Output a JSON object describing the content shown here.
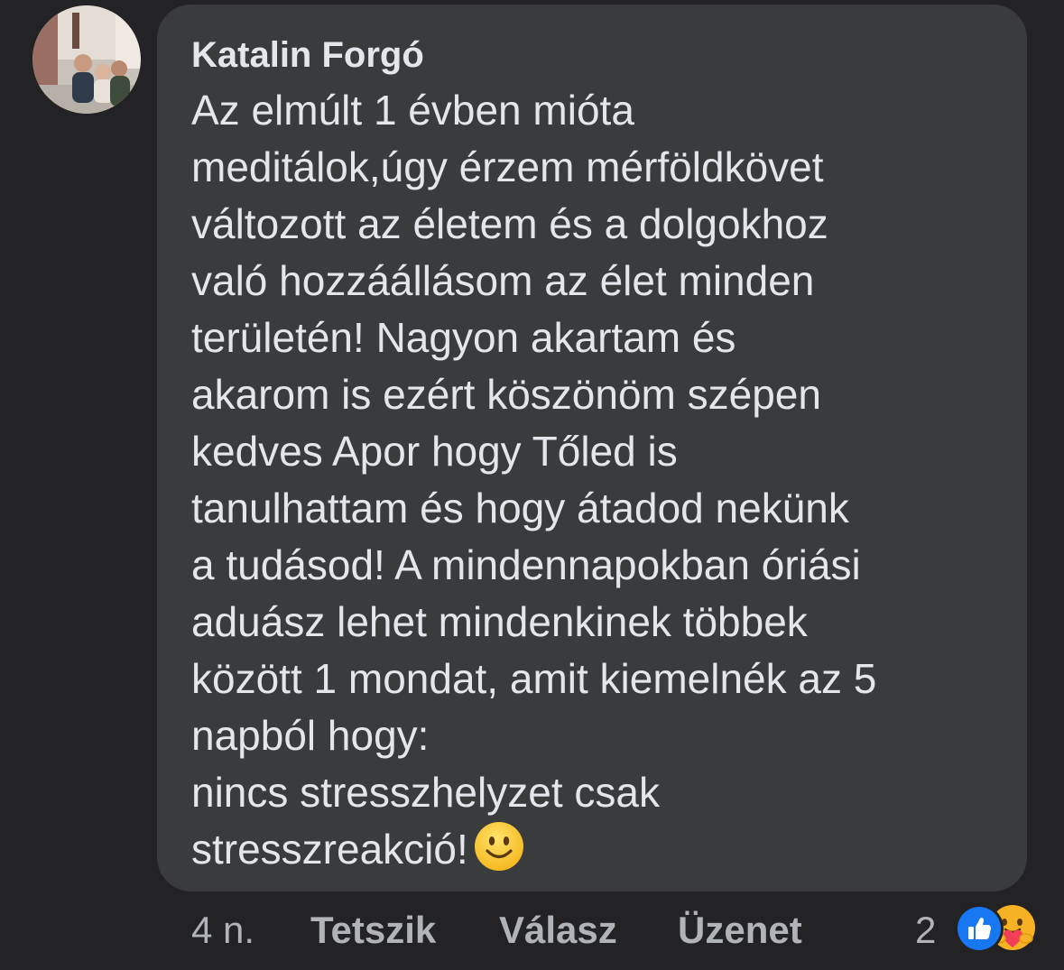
{
  "comment": {
    "author": "Katalin Forgó",
    "text": "Az elmúlt 1 évben mióta\nmeditálok,úgy érzem mérföldkövet\nváltozott az életem és a dolgokhoz\nvaló hozzáállásom az élet minden\nterületén! Nagyon  akartam és\nakarom is ezért köszönöm szépen\nkedves Apor hogy Tőled is\ntanulhattam és hogy átadod nekünk\na tudásod! A mindennapokban óriási\naduász lehet mindenkinek többek\nközött 1 mondat, amit kiemelnék az 5\nnapból hogy:\n nincs stresszhelyzet csak\nstresszreakció!",
    "emoji": "slightly-smiling-face-emoji"
  },
  "actions": {
    "time": "4 n.",
    "like_label": "Tetszik",
    "reply_label": "Válasz",
    "message_label": "Üzenet"
  },
  "reactions": {
    "count": "2",
    "icons": [
      "like-reaction-icon",
      "care-reaction-icon"
    ],
    "like_color": "#1877f2",
    "care_color": "#f7b125"
  },
  "colors": {
    "background": "#232325",
    "bubble": "#3a3b3c",
    "text": "#e4e6eb",
    "secondary_text": "#b0b3b8"
  }
}
